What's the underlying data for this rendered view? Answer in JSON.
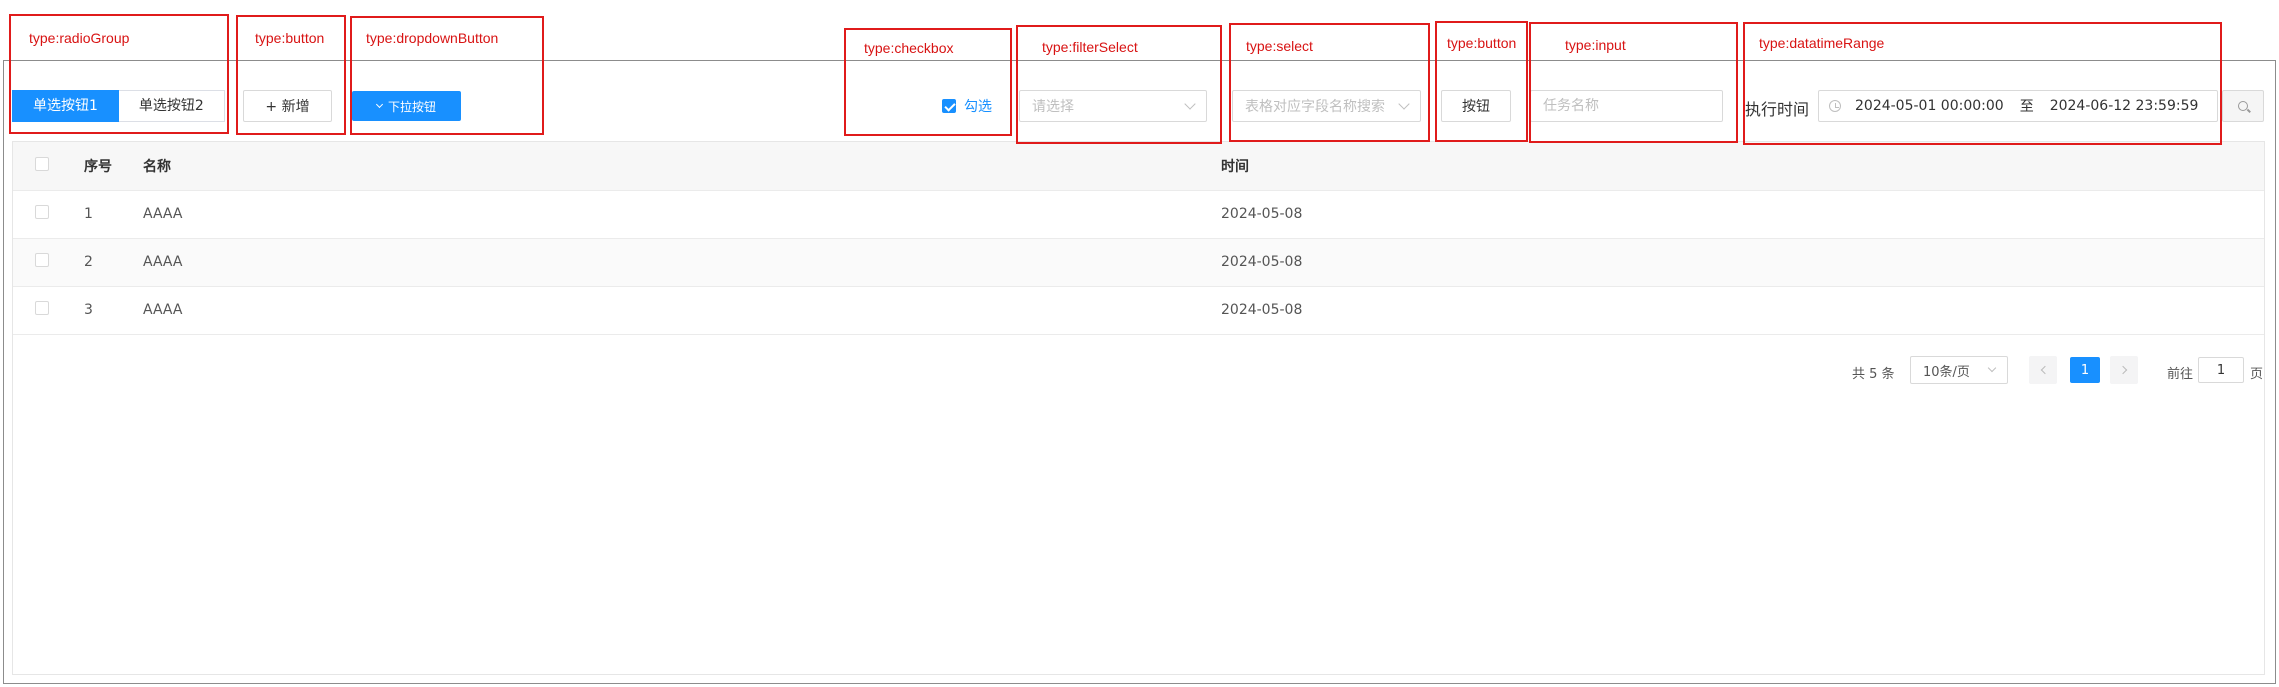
{
  "annotations": [
    {
      "id": "radioGroup",
      "label": "type:radioGroup"
    },
    {
      "id": "button",
      "label": "type:button"
    },
    {
      "id": "dropdownButton",
      "label": "type:dropdownButton"
    },
    {
      "id": "checkbox",
      "label": "type:checkbox"
    },
    {
      "id": "filterSelect",
      "label": "type:filterSelect"
    },
    {
      "id": "select",
      "label": "type:select"
    },
    {
      "id": "button2",
      "label": "type:button"
    },
    {
      "id": "input",
      "label": "type:input"
    },
    {
      "id": "datetimeRange",
      "label": "type:datatimeRange"
    }
  ],
  "toolbar": {
    "radio_options": [
      "单选按钮1",
      "单选按钮2"
    ],
    "radio_selected": 0,
    "add_button": "+ 新增",
    "dropdown_button": "下拉按钮",
    "checkbox_label": "勾选",
    "checkbox_checked": true,
    "filter_select_placeholder": "请选择",
    "select_placeholder": "表格对应字段名称搜索",
    "plain_button": "按钮",
    "input_placeholder": "任务名称",
    "datetime_label": "执行时间",
    "datetime_start": "2024-05-01 00:00:00",
    "datetime_sep": "至",
    "datetime_end": "2024-06-12 23:59:59"
  },
  "table": {
    "columns": [
      "序号",
      "名称",
      "时间"
    ],
    "rows": [
      [
        "1",
        "AAAA",
        "2024-05-08"
      ],
      [
        "2",
        "AAAA",
        "2024-05-08"
      ],
      [
        "3",
        "AAAA",
        "2024-05-08"
      ]
    ]
  },
  "pagination": {
    "total_text": "共 5 条",
    "page_size": "10条/页",
    "current_page": "1",
    "goto_prefix": "前往",
    "goto_value": "1",
    "goto_suffix": "页"
  },
  "colors": {
    "primary": "#1890ff",
    "annotation": "#e01b1b"
  }
}
